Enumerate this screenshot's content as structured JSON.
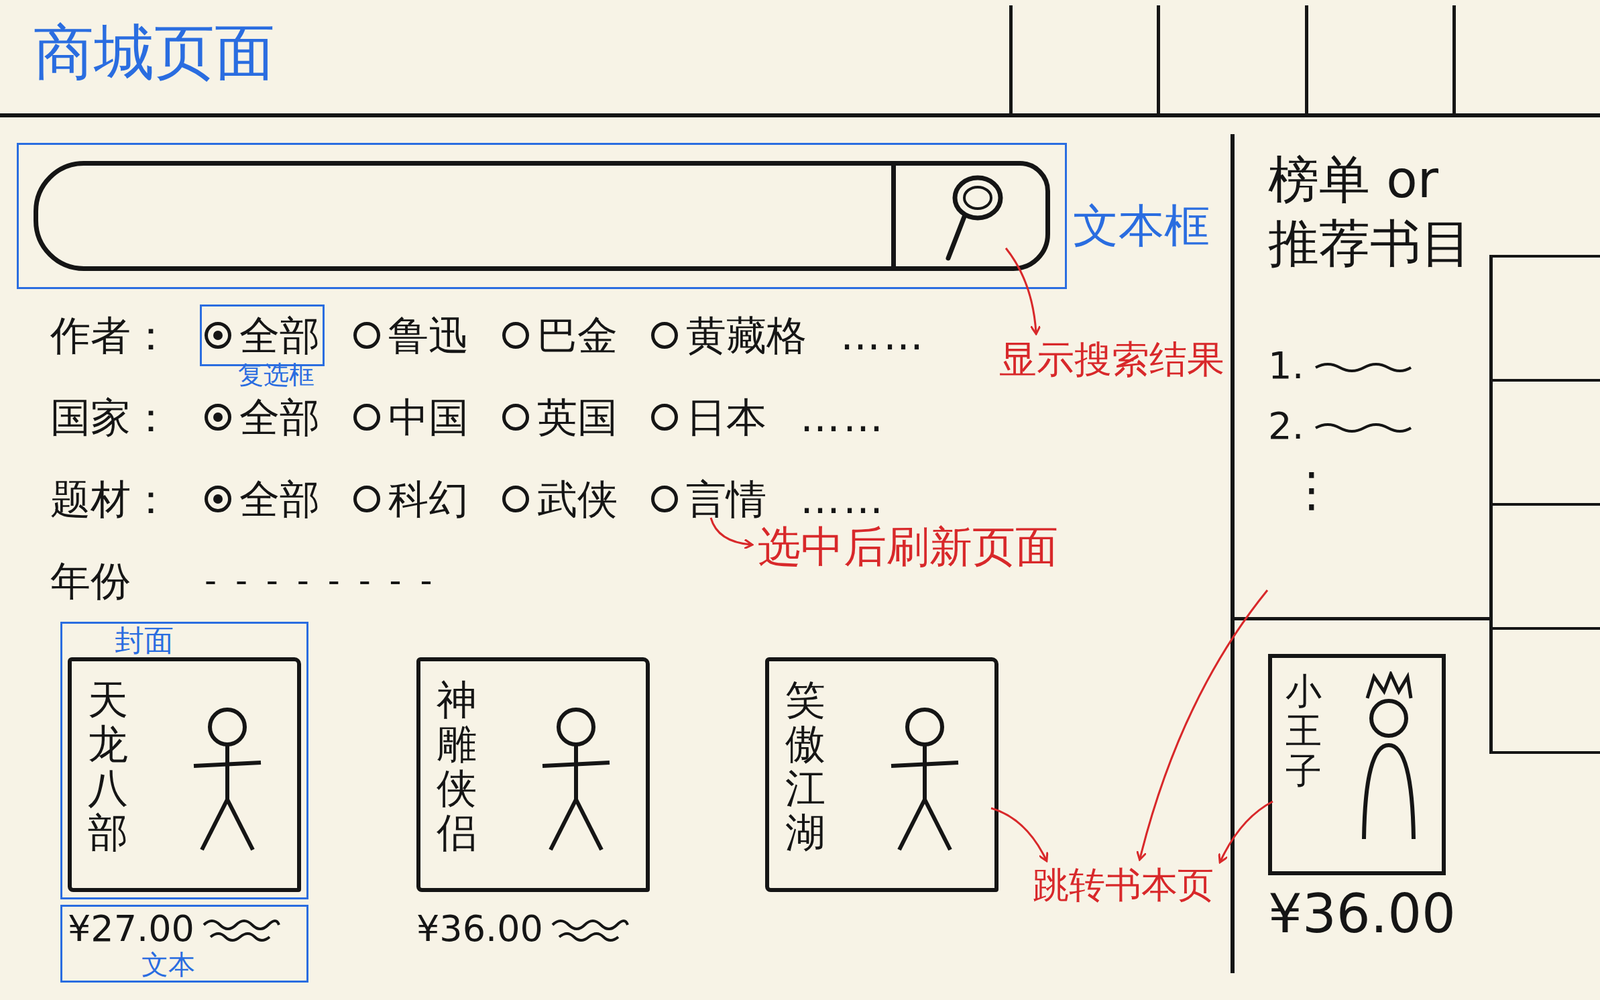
{
  "page": {
    "title": "商城页面"
  },
  "search": {
    "placeholder": ""
  },
  "filters": [
    {
      "label": "作者：",
      "options": [
        {
          "label": "全部",
          "selected": true
        },
        {
          "label": "鲁迅",
          "selected": false
        },
        {
          "label": "巴金",
          "selected": false
        },
        {
          "label": "黄藏格",
          "selected": false
        }
      ],
      "more": "……"
    },
    {
      "label": "国家：",
      "options": [
        {
          "label": "全部",
          "selected": true
        },
        {
          "label": "中国",
          "selected": false
        },
        {
          "label": "英国",
          "selected": false
        },
        {
          "label": "日本",
          "selected": false
        }
      ],
      "more": "……"
    },
    {
      "label": "题材：",
      "options": [
        {
          "label": "全部",
          "selected": true
        },
        {
          "label": "科幻",
          "selected": false
        },
        {
          "label": "武侠",
          "selected": false
        },
        {
          "label": "言情",
          "selected": false
        }
      ],
      "more": "……"
    }
  ],
  "year": {
    "label": "年份",
    "placeholder": "- - - - - - - -"
  },
  "books": [
    {
      "title": "天龙八部",
      "price": "¥27.00"
    },
    {
      "title": "神雕侠侣",
      "price": "¥36.00"
    },
    {
      "title": "笑傲江湖"
    }
  ],
  "sidebar": {
    "title": "榜单 or 推荐书目",
    "ranks": [
      "1.",
      "2.",
      "⋮"
    ],
    "book": {
      "title": "小王子",
      "price": "¥36.00"
    }
  },
  "annotations": [
    {
      "kind": "search-box",
      "text": "文本框",
      "color": "#2a6de0"
    },
    {
      "kind": "search-result",
      "text": "显示搜索结果",
      "color": "#d8282a"
    },
    {
      "kind": "filter-option",
      "text": "复选框",
      "color": "#2a6de0"
    },
    {
      "kind": "refresh",
      "text": "选中后刷新页面",
      "color": "#d8282a"
    },
    {
      "kind": "cover",
      "text": "封面",
      "color": "#2a6de0"
    },
    {
      "kind": "price",
      "text": "文本",
      "color": "#2a6de0"
    },
    {
      "kind": "jump",
      "text": "跳转书本页",
      "color": "#d8282a"
    }
  ]
}
